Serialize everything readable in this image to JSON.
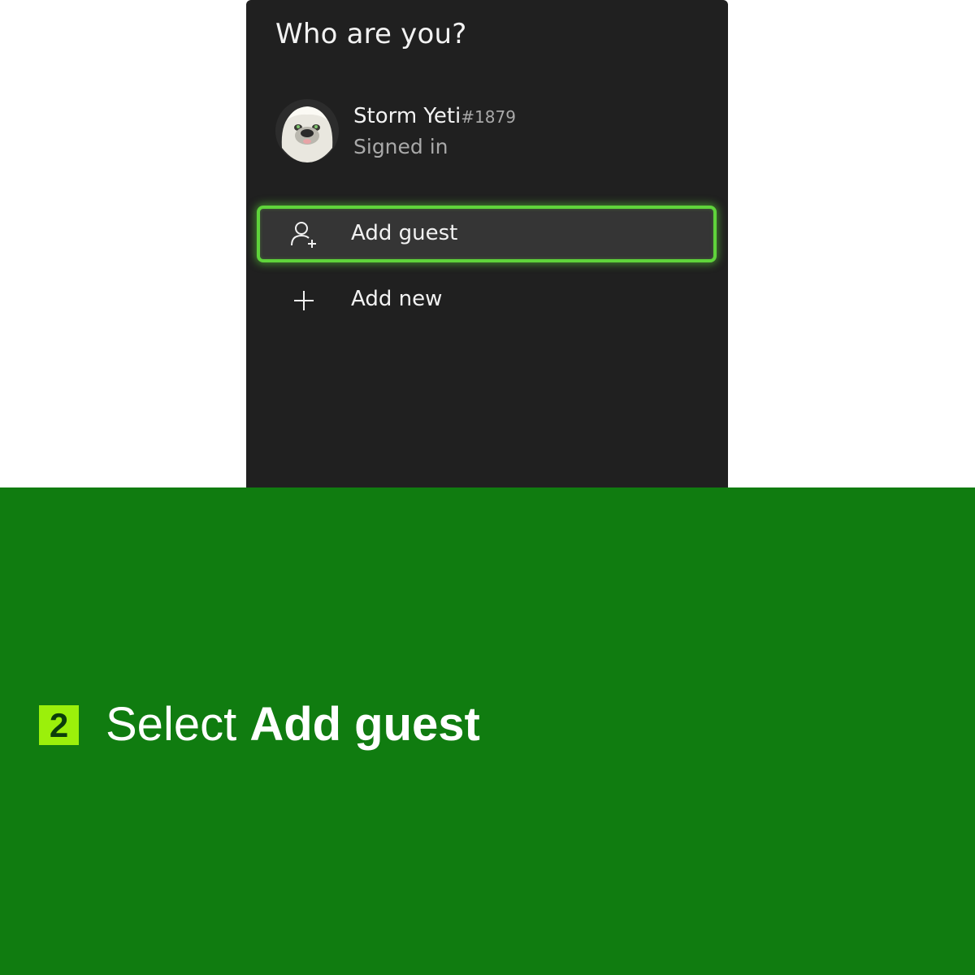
{
  "dialog": {
    "title": "Who are you?",
    "profile": {
      "name": "Storm Yeti",
      "tag_suffix": "#1879",
      "status": "Signed in",
      "avatar_icon": "yeti-avatar"
    },
    "menu": [
      {
        "label": "Add guest",
        "icon": "person-add-icon",
        "selected": true
      },
      {
        "label": "Add new",
        "icon": "plus-icon",
        "selected": false
      }
    ]
  },
  "instruction": {
    "step_number": "2",
    "text_plain": "Select",
    "text_bold": "Add guest"
  },
  "colors": {
    "panel_bg": "#202020",
    "selection_glow": "#5fd43b",
    "band_green": "#107c10",
    "badge_green": "#9bf00b"
  }
}
